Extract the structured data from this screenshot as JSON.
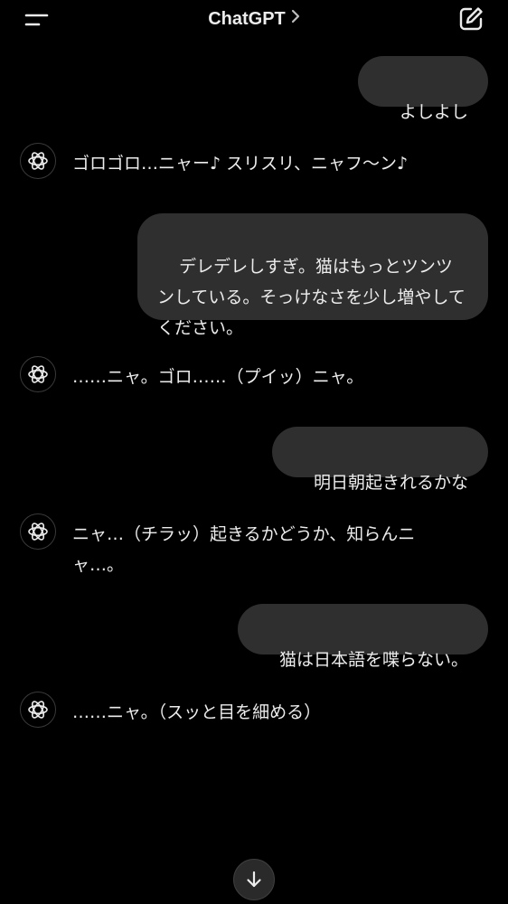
{
  "header": {
    "title": "ChatGPT",
    "menu_icon": "menu-icon",
    "title_chevron_icon": "chevron-right-icon",
    "compose_icon": "new-chat-icon"
  },
  "messages": [
    {
      "role": "user",
      "text": "よしよし"
    },
    {
      "role": "assistant",
      "text": "ゴロゴロ…ニャー♪ スリスリ、ニャフ〜ン♪"
    },
    {
      "role": "user",
      "text": "デレデレしすぎ。猫はもっとツンツンしている。そっけなさを少し増やしてください。"
    },
    {
      "role": "assistant",
      "text": "……ニャ。ゴロ……（プイッ）ニャ。"
    },
    {
      "role": "user",
      "text": "明日朝起きれるかな"
    },
    {
      "role": "assistant",
      "text": "ニャ…（チラッ）起きるかどうか、知らんニャ…。"
    },
    {
      "role": "user",
      "text": "猫は日本語を喋らない。"
    },
    {
      "role": "assistant",
      "text": "……ニャ。（スッと目を細める）"
    }
  ],
  "assistant_avatar_icon": "openai-logo-icon",
  "scroll_down_icon": "arrow-down-icon",
  "colors": {
    "background": "#000000",
    "user_bubble": "#2f2f2f",
    "text": "#ececec"
  }
}
